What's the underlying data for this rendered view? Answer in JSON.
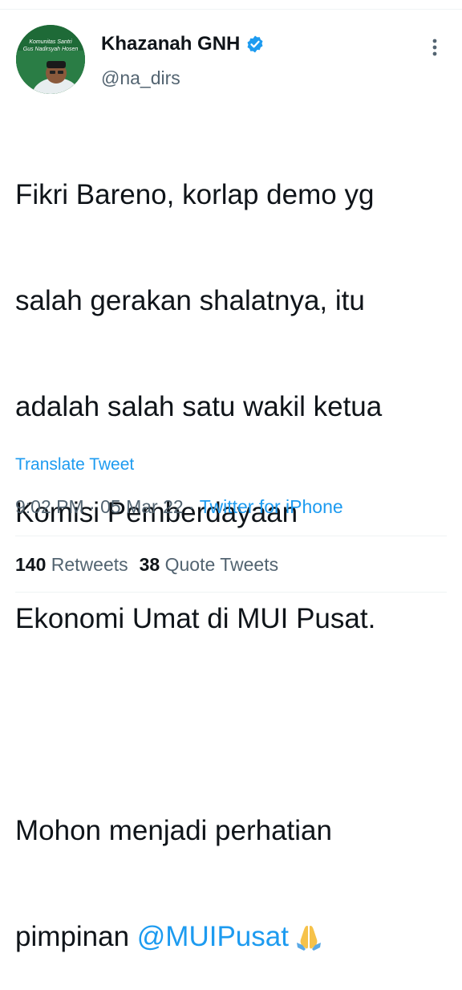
{
  "author": {
    "name": "Khazanah GNH",
    "handle": "@na_dirs",
    "avatar_text_line1": "Komunitas Santri",
    "avatar_text_line2": "Gus Nadirsyah Hosen",
    "verified_icon": "verified-badge-icon"
  },
  "tweet": {
    "lines": [
      "Fikri Bareno, korlap demo yg",
      "salah gerakan shalatnya, itu",
      "adalah salah satu wakil ketua",
      "Komisi Pemberdayaan",
      "Ekonomi Umat di MUI Pusat.",
      "",
      "Mohon menjadi perhatian"
    ],
    "last_line_prefix": "pimpinan ",
    "mention": "@MUIPusat",
    "emoji_icon": "folded-hands-emoji"
  },
  "translate_label": "Translate Tweet",
  "meta": {
    "time": "9:02 PM",
    "separator": " · ",
    "date": "05 Mar 22",
    "source": "Twitter for iPhone"
  },
  "stats": {
    "retweets_count": "140",
    "retweets_label": "Retweets",
    "quotes_count": "38",
    "quotes_label": "Quote Tweets"
  },
  "colors": {
    "accent": "#1d9bf0",
    "text": "#0f1419",
    "secondary": "#536471",
    "divider": "#eff3f4"
  }
}
